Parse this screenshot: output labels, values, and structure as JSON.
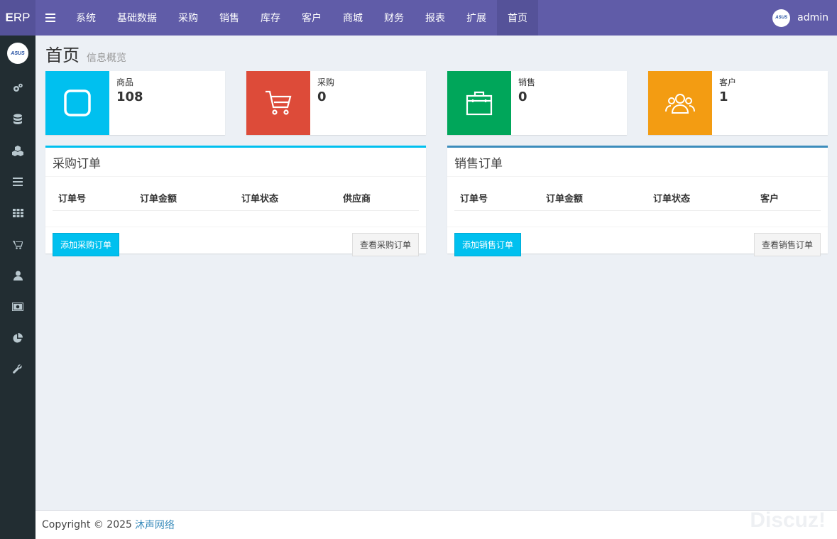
{
  "brand": {
    "first": "E",
    "rest": "RP"
  },
  "topnav": {
    "items": [
      "系统",
      "基础数据",
      "采购",
      "销售",
      "库存",
      "客户",
      "商城",
      "财务",
      "报表",
      "扩展",
      "首页"
    ],
    "active_index": 10
  },
  "user": {
    "name": "admin",
    "avatar_text": "ASUS"
  },
  "sidebar": {
    "avatar_text": "ASUS",
    "icons": [
      "gears-icon",
      "database-icon",
      "cubes-icon",
      "list-icon",
      "grid-icon",
      "cart-icon",
      "user-icon",
      "money-icon",
      "pie-chart-icon",
      "wrench-icon"
    ]
  },
  "page": {
    "title": "首页",
    "subtitle": "信息概览"
  },
  "info_boxes": [
    {
      "label": "商品",
      "value": "108",
      "color": "#00c0ef",
      "icon": "square-icon"
    },
    {
      "label": "采购",
      "value": "0",
      "color": "#dd4b39",
      "icon": "cart-icon"
    },
    {
      "label": "销售",
      "value": "0",
      "color": "#00a65a",
      "icon": "briefcase-icon"
    },
    {
      "label": "客户",
      "value": "1",
      "color": "#f39c12",
      "icon": "users-icon"
    }
  ],
  "purchase_box": {
    "title": "采购订单",
    "accent": "#00c0ef",
    "columns": [
      "订单号",
      "订单金额",
      "订单状态",
      "供应商"
    ],
    "add_button": "添加采购订单",
    "view_button": "查看采购订单"
  },
  "sales_box": {
    "title": "销售订单",
    "accent": "#3c8dbc",
    "columns": [
      "订单号",
      "订单金额",
      "订单状态",
      "客户"
    ],
    "add_button": "添加销售订单",
    "view_button": "查看销售订单"
  },
  "footer": {
    "copyright": "Copyright © 2025",
    "company": "沐声网络"
  },
  "watermark": "Discuz!"
}
